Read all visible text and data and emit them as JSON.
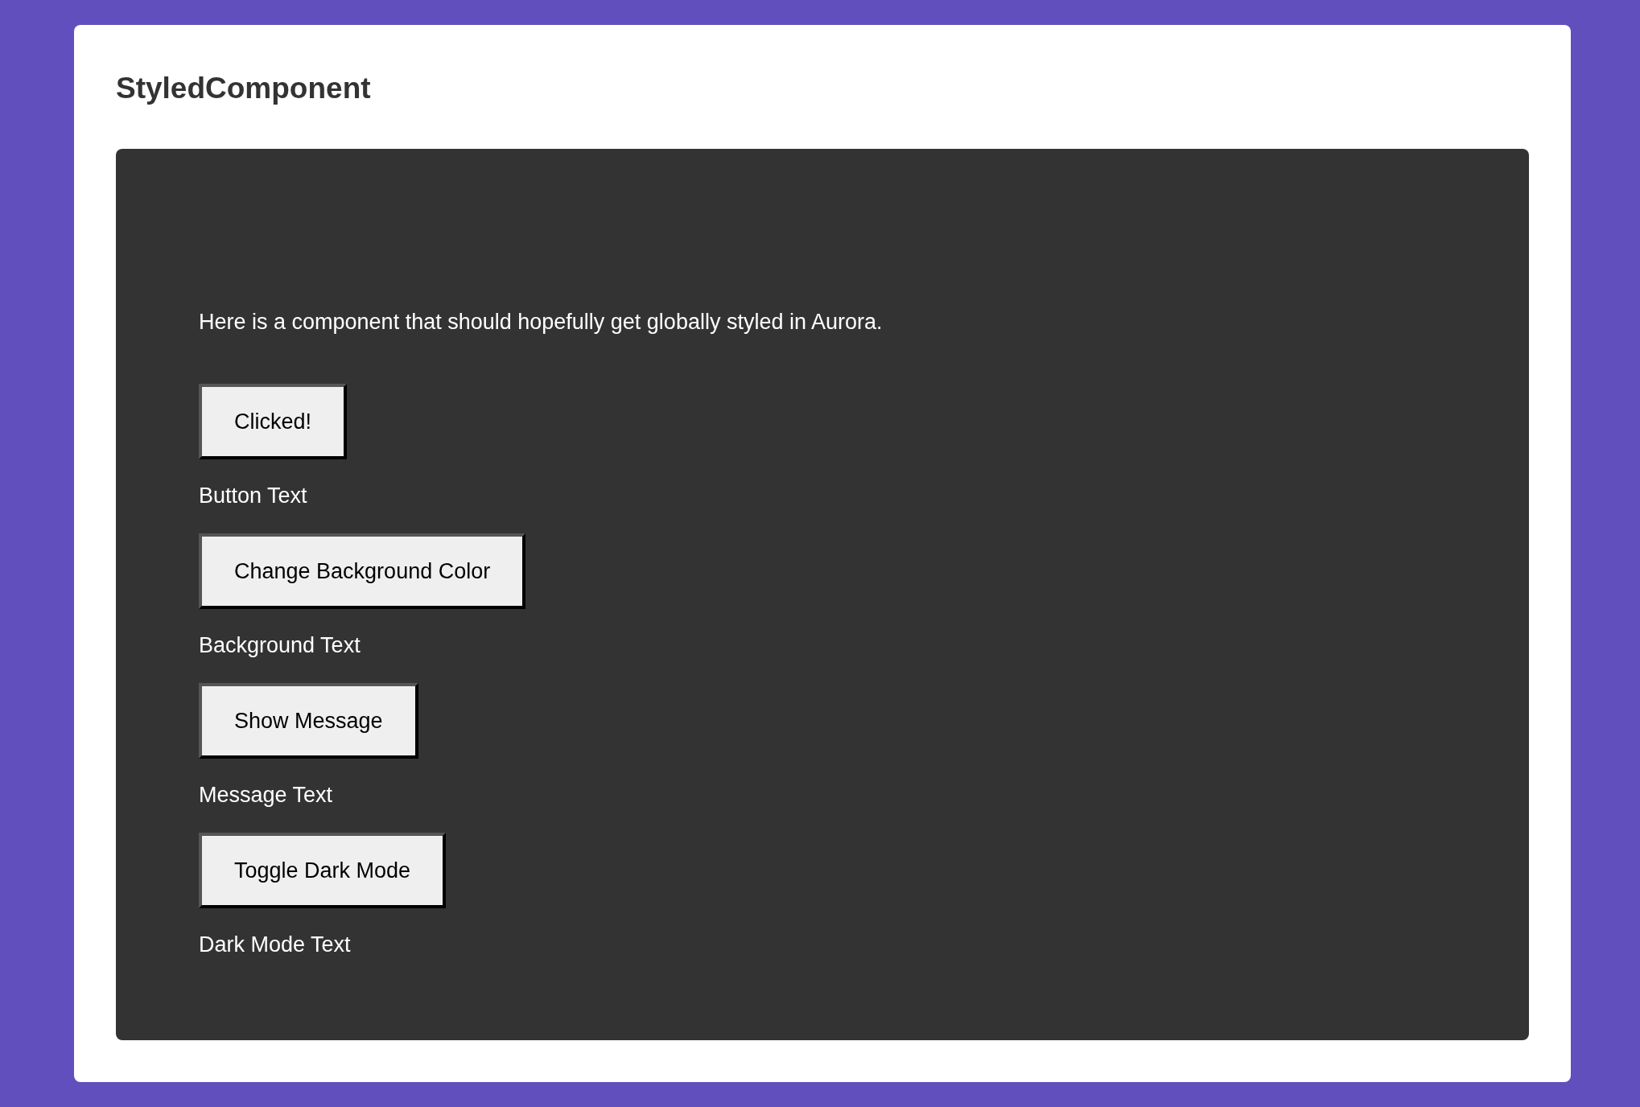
{
  "title": "StyledComponent",
  "panel": {
    "description": "Here is a component that should hopefully get globally styled in Aurora.",
    "controls": [
      {
        "button": "Clicked!",
        "text": "Button Text"
      },
      {
        "button": "Change Background Color",
        "text": "Background Text"
      },
      {
        "button": "Show Message",
        "text": "Message Text"
      },
      {
        "button": "Toggle Dark Mode",
        "text": "Dark Mode Text"
      }
    ]
  }
}
